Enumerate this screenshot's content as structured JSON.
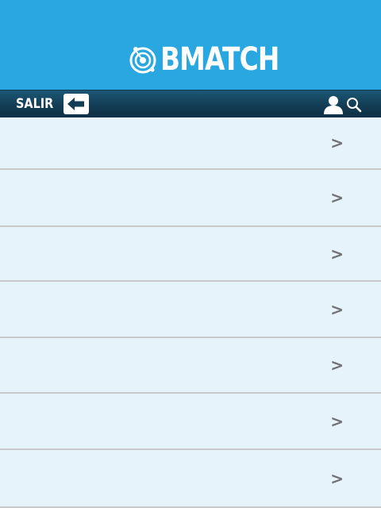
{
  "header": {
    "logo_text": "BMATCH",
    "background_color": "#28a7e0"
  },
  "toolbar": {
    "exit_label": "SALIR",
    "exit_icon": "arrow-left-icon",
    "user_icon": "user-icon",
    "search_icon": "search-icon"
  },
  "list": {
    "items": [
      {
        "label": "",
        "chevron": ">"
      },
      {
        "label": "",
        "chevron": ">"
      },
      {
        "label": "",
        "chevron": ">"
      },
      {
        "label": "",
        "chevron": ">"
      },
      {
        "label": "",
        "chevron": ">"
      },
      {
        "label": "",
        "chevron": ">"
      },
      {
        "label": "",
        "chevron": ">"
      }
    ]
  },
  "colors": {
    "brand_blue": "#28a7e0",
    "toolbar_navy": "#133d55",
    "list_background": "#e7f3fb",
    "divider": "#c8c9ca",
    "chevron": "#707274"
  }
}
